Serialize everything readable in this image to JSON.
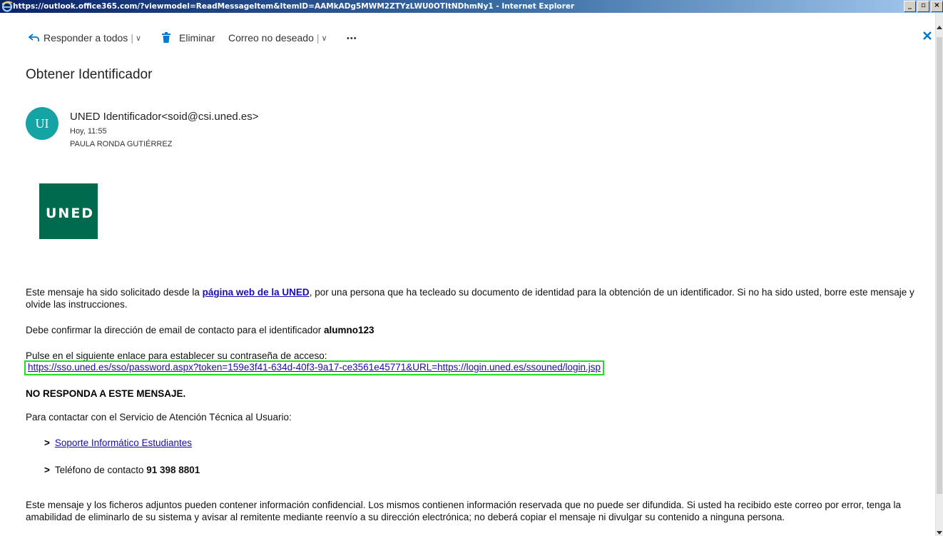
{
  "window": {
    "title": "https://outlook.office365.com/?viewmodel=ReadMessageItem&ItemID=AAMkADg5MWM2ZTYzLWU0OTItNDhmNy1 - Internet Explorer",
    "min_label": "_",
    "max_label": "▫",
    "close_label": "×"
  },
  "toolbar": {
    "reply_all_label": "Responder a todos",
    "delete_label": "Eliminar",
    "junk_label": "Correo no deseado",
    "more_label": "•••",
    "separator": "|",
    "chevron": "∨"
  },
  "message": {
    "subject": "Obtener Identificador",
    "avatar_initials": "UI",
    "avatar_color": "#16a3a3",
    "sender": "UNED Identificador<soid@csi.uned.es>",
    "time": "Hoy, 11:55",
    "recipient": "PAULA RONDA GUTIÉRREZ"
  },
  "body": {
    "logo_text": "UNED",
    "logo_color": "#006a4e",
    "p1_before": "Este mensaje ha sido solicitado desde la ",
    "p1_link": "página web de la UNED",
    "p1_after": ", por una persona que ha tecleado su documento de identidad para la obtención de un identificador. Si no ha sido usted, borre este mensaje y olvide las instrucciones.",
    "p2_text": "Debe confirmar la dirección de email de contacto para el identificador ",
    "p2_user": "alumno123",
    "p3_text": "Pulse en el siguiente enlace para establecer su contraseña de acceso:",
    "reset_link": "https://sso.uned.es/sso/password.aspx?token=159e3f41-634d-40f3-9a17-ce3561e45771&URL=https://login.uned.es/ssouned/login.jsp",
    "no_reply": "NO RESPONDA A ESTE MENSAJE.",
    "contact_intro": "Para contactar con el Servicio de Atención Técnica al Usuario:",
    "bullet": ">",
    "support_link": "Soporte Informático Estudiantes",
    "phone_label": "Teléfono de contacto ",
    "phone_number": "91 398 8801",
    "disclaimer": "Este mensaje y los ficheros adjuntos pueden contener información confidencial. Los mismos contienen información reservada que no puede ser difundida. Si usted ha recibido este correo por error, tenga la amabilidad de eliminarlo de su sistema y avisar al remitente mediante reenvío a su dirección electrónica; no deberá copiar el mensaje ni divulgar su contenido a ninguna persona."
  }
}
